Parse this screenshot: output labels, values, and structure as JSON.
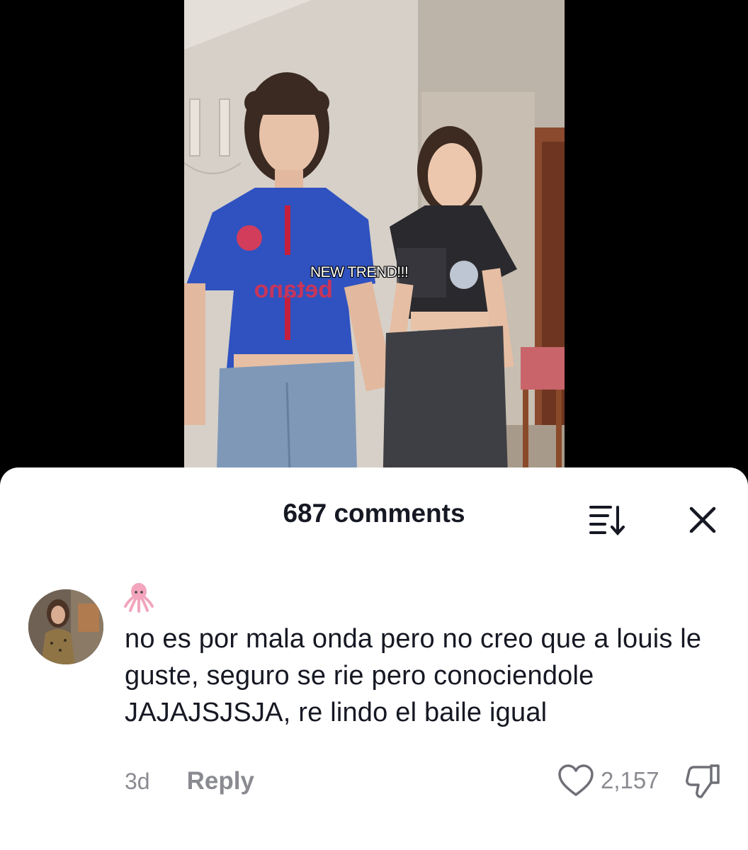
{
  "video": {
    "caption": "NEW TREND!!!"
  },
  "comments_sheet": {
    "title": "687 comments",
    "sort_icon": "sort-descending-icon",
    "close_icon": "close-icon"
  },
  "comment": {
    "username_emoji": "octopus-emoji",
    "text": "no es por mala onda pero no creo que a louis le guste, seguro se rie pero conociendole JAJAJSJSJA, re lindo el baile igual",
    "time": "3d",
    "reply_label": "Reply",
    "like_count": "2,157",
    "like_icon": "heart-outline-icon",
    "dislike_icon": "thumbs-down-icon"
  },
  "colors": {
    "text_primary": "#161823",
    "text_secondary": "#8a8b91",
    "sheet_bg": "#ffffff"
  }
}
